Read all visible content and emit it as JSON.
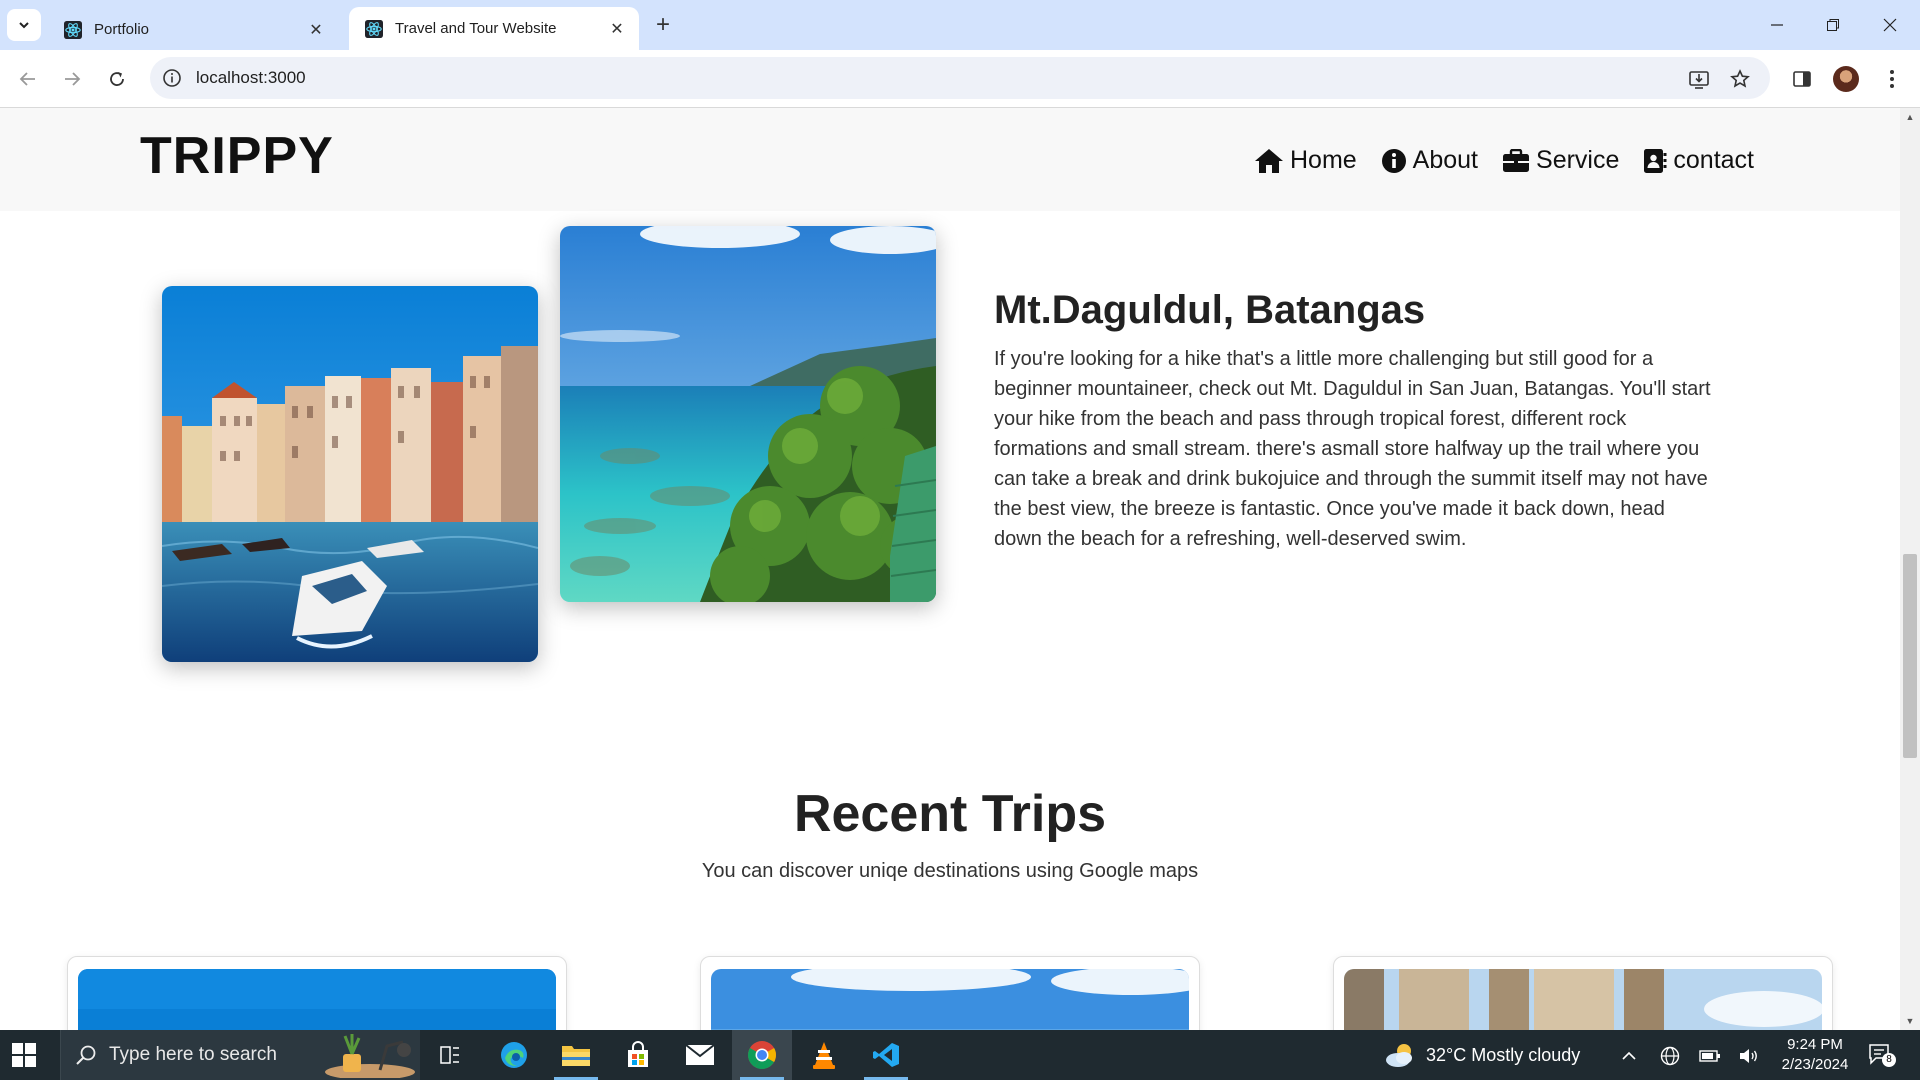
{
  "browser": {
    "tabs": [
      {
        "title": "Portfolio",
        "active": false
      },
      {
        "title": "Travel and Tour Website",
        "active": true
      }
    ],
    "url": "localhost:3000"
  },
  "site": {
    "brand": "TRIPPY",
    "nav": [
      {
        "label": "Home",
        "icon": "home-icon"
      },
      {
        "label": "About",
        "icon": "info-icon"
      },
      {
        "label": "Service",
        "icon": "briefcase-icon"
      },
      {
        "label": "contact",
        "icon": "address-book-icon"
      }
    ]
  },
  "destination": {
    "title": "Mt.Daguldul, Batangas",
    "text": "If you're looking for a hike that's a little more challenging but still good for a beginner mountaineer, check out Mt. Daguldul in San Juan, Batangas. You'll start your hike from the beach and pass through tropical forest, different rock formations and small stream. there's asmall store halfway up the trail where you can take a break and drink bukojuice and through the summit itself may not have the best view, the breeze is fantastic. Once you've made it back down, head down the beach for a refreshing, well-deserved swim."
  },
  "recent_trips": {
    "title": "Recent Trips",
    "subtitle": "You can discover uniqe destinations using Google maps"
  },
  "taskbar": {
    "search_placeholder": "Type here to search",
    "weather": "32°C  Mostly cloudy",
    "time": "9:24 PM",
    "date": "2/23/2024",
    "notification_count": "8"
  }
}
